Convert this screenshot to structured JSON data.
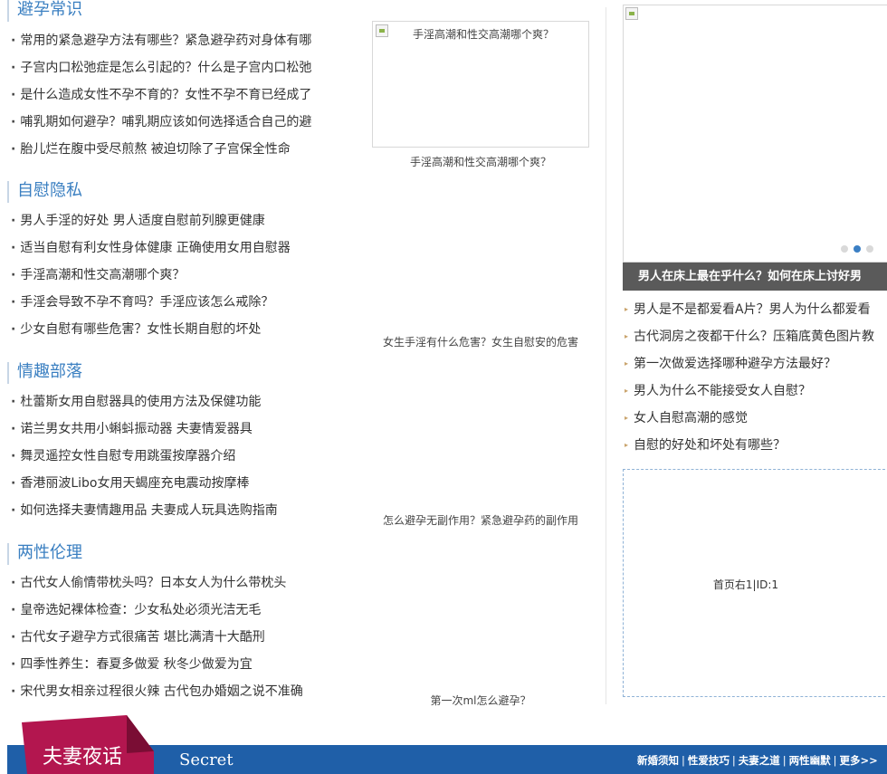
{
  "sections": [
    {
      "title": "避孕常识",
      "items": [
        "常用的紧急避孕方法有哪些？紧急避孕药对身体有哪",
        "子宫内口松弛症是怎么引起的？什么是子宫内口松弛",
        "是什么造成女性不孕不育的？女性不孕不育已经成了",
        "哺乳期如何避孕？哺乳期应该如何选择适合自己的避",
        "胎儿烂在腹中受尽煎熬 被迫切除了子宫保全性命"
      ]
    },
    {
      "title": "自慰隐私",
      "items": [
        "男人手淫的好处 男人适度自慰前列腺更健康",
        "适当自慰有利女性身体健康 正确使用女用自慰器",
        "手淫高潮和性交高潮哪个爽？",
        "手淫会导致不孕不育吗？手淫应该怎么戒除？",
        "少女自慰有哪些危害？女性长期自慰的坏处"
      ]
    },
    {
      "title": "情趣部落",
      "items": [
        "杜蕾斯女用自慰器具的使用方法及保健功能",
        "诺兰男女共用小蝌蚪振动器 夫妻情爱器具",
        "舞灵遥控女性自慰专用跳蛋按摩器介绍",
        "香港丽波Libo女用天蝎座充电震动按摩棒",
        "如何选择夫妻情趣用品 夫妻成人玩具选购指南"
      ]
    },
    {
      "title": "两性伦理",
      "items": [
        "古代女人偷情带枕头吗？日本女人为什么带枕头",
        "皇帝选妃裸体检查：少女私处必须光洁无毛",
        "古代女子避孕方式很痛苦 堪比满清十大酷刑",
        "四季性养生：春夏多做爱 秋冬少做爱为宜",
        "宋代男女相亲过程很火辣 古代包办婚姻之说不准确"
      ]
    }
  ],
  "middle": {
    "image_alt": "手淫高潮和性交高潮哪个爽？",
    "captions": [
      "手淫高潮和性交高潮哪个爽？",
      "女生手淫有什么危害？女生自慰安的危害",
      "怎么避孕无副作用？紧急避孕药的副作用",
      "第一次ml怎么避孕？"
    ]
  },
  "right": {
    "slider_caption": "男人在床上最在乎什么？如何在床上讨好男",
    "slider_active_dot": 2,
    "items": [
      "男人是不是都爱看A片？男人为什么都爱看",
      "古代洞房之夜都干什么？压箱底黄色图片教",
      "第一次做爱选择哪种避孕方法最好？",
      "男人为什么不能接受女人自慰？",
      "女人自慰高潮的感觉",
      "自慰的好处和坏处有哪些？"
    ],
    "ad_label": "首页右1|ID:1"
  },
  "footer": {
    "tag": "夫妻夜话",
    "subtitle": "Secret",
    "links": [
      "新婚须知",
      "性爱技巧",
      "夫妻之道",
      "两性幽默",
      "更多>>"
    ],
    "colors": {
      "bar": "#1f5fa8",
      "tag": "#b3164f"
    }
  }
}
